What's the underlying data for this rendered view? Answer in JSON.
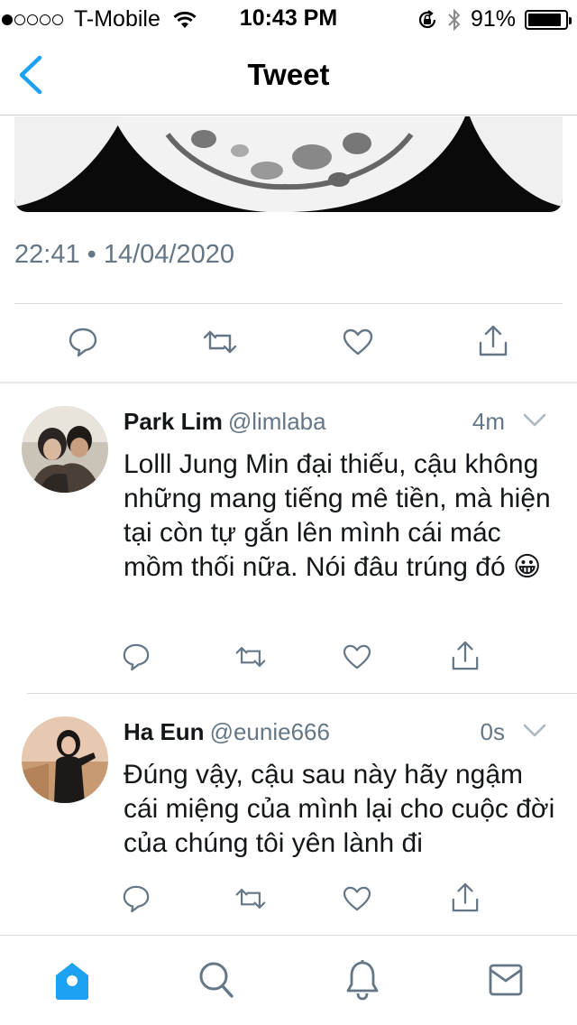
{
  "status_bar": {
    "carrier": "T-Mobile",
    "time": "10:43 PM",
    "battery": "91%",
    "battery_level": 0.91
  },
  "nav": {
    "title": "Tweet"
  },
  "tweet": {
    "timestamp": "22:41 • 14/04/2020"
  },
  "replies": [
    {
      "name": "Park Lim",
      "handle": "@limlaba",
      "time": "4m",
      "text": "Lolll Jung Min đại thiếu, cậu không những mang tiếng mê tiền, mà hiện tại còn tự gắn lên mình cái mác mồm thối nữa. Nói đâu trúng đó 😀"
    },
    {
      "name": "Ha Eun",
      "handle": "@eunie666",
      "time": "0s",
      "text": "Đúng vậy, cậu sau này hãy ngậm cái miệng của mình lại cho cuộc đời của chúng tôi yên lành đi"
    }
  ],
  "icons": {
    "reply": "reply-icon",
    "retweet": "retweet-icon",
    "like": "heart-icon",
    "share": "share-icon",
    "home": "home-icon",
    "search": "search-icon",
    "notifications": "bell-icon",
    "messages": "mail-icon"
  },
  "colors": {
    "accent": "#1da1f2",
    "icon_gray": "#657786",
    "text": "#14171a"
  }
}
